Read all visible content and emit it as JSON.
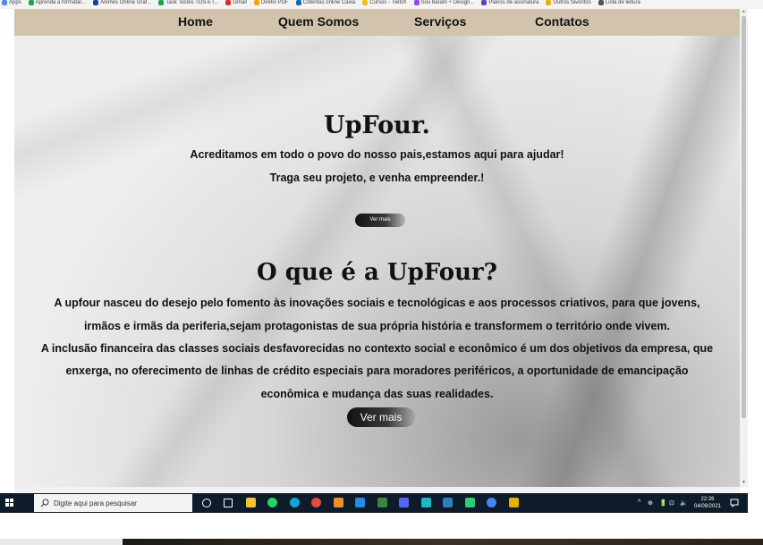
{
  "bookmarks": {
    "items": [
      {
        "label": "Apps",
        "color": "#4a8af4"
      },
      {
        "label": "Aprenda a formatar...",
        "color": "#1aa34a"
      },
      {
        "label": "Animes Online Grát...",
        "color": "#1a3f8c"
      },
      {
        "label": "Task Testes TDS-ET...",
        "color": "#1aa34a"
      },
      {
        "label": "Gmail",
        "color": "#d93025"
      },
      {
        "label": "Diretiv PDF",
        "color": "#f4a400"
      },
      {
        "label": "Cotentas online Caixa",
        "color": "#0a6ebd"
      },
      {
        "label": "Cursos - Twitch",
        "color": "#f1c40f"
      },
      {
        "label": "Sou barato + Design...",
        "color": "#9146ff"
      },
      {
        "label": "Planos de assinatura",
        "color": "#6c3fb5"
      },
      {
        "label": "Outros favoritos",
        "color": "#e8b100"
      },
      {
        "label": "Lista de leitura",
        "color": "#555555"
      }
    ]
  },
  "nav": {
    "home": "Home",
    "about": "Quem Somos",
    "services": "Serviços",
    "contacts": "Contatos"
  },
  "hero": {
    "title": "UpFour.",
    "line1": "Acreditamos em todo o povo do nosso pais,estamos aqui para ajudar!",
    "line2": "Traga seu projeto, e venha empreender.!",
    "button": "Ver mais"
  },
  "about": {
    "title": "O que é a UpFour?",
    "lines": [
      "A upfour nasceu do desejo pelo fomento às inovações sociais e tecnológicas e aos processos criativos, para que jovens,",
      "irmãos e irmãs da periferia,sejam protagonistas de sua própria história e transformem o território onde vivem.",
      "A inclusão financeira das classes sociais desfavorecidas no contexto social e econômico é um dos objetivos da empresa, que",
      "enxerga, no oferecimento de linhas de crédito especiais para moradores periféricos, a oportunidade de emancipação",
      "econômica e mudança das suas realidades."
    ],
    "button": "Ver mais"
  },
  "taskbar": {
    "search_placeholder": "Digite aqui para pesquisar",
    "time": "22:26",
    "date": "04/09/2021",
    "colors": {
      "bar": "#0d1b2a",
      "search": "#f3f3f3"
    },
    "icons": [
      {
        "name": "cortana-icon",
        "color": "#ffffff"
      },
      {
        "name": "task-view-icon",
        "color": "#ffffff"
      },
      {
        "name": "file-explorer-icon",
        "color": "#f4c430"
      },
      {
        "name": "whatsapp-icon",
        "color": "#25d366"
      },
      {
        "name": "edge-icon",
        "color": "#0fa3d8"
      },
      {
        "name": "chrome-icon",
        "color": "#e44d3a"
      },
      {
        "name": "sublime-icon",
        "color": "#f28c28"
      },
      {
        "name": "vscode-icon",
        "color": "#2a8ae2"
      },
      {
        "name": "node-icon",
        "color": "#3c873a"
      },
      {
        "name": "discord-icon",
        "color": "#5865f2"
      },
      {
        "name": "browser-icon",
        "color": "#1db9c3"
      },
      {
        "name": "photo-app-icon",
        "color": "#2f7fbf"
      },
      {
        "name": "terminal-icon",
        "color": "#2ecc71"
      },
      {
        "name": "chrome-dev-icon",
        "color": "#4285f4"
      },
      {
        "name": "git-icon",
        "color": "#e8b100"
      }
    ],
    "tray": [
      "^",
      "⊕",
      "🔋",
      "⊡",
      "🔈"
    ]
  }
}
